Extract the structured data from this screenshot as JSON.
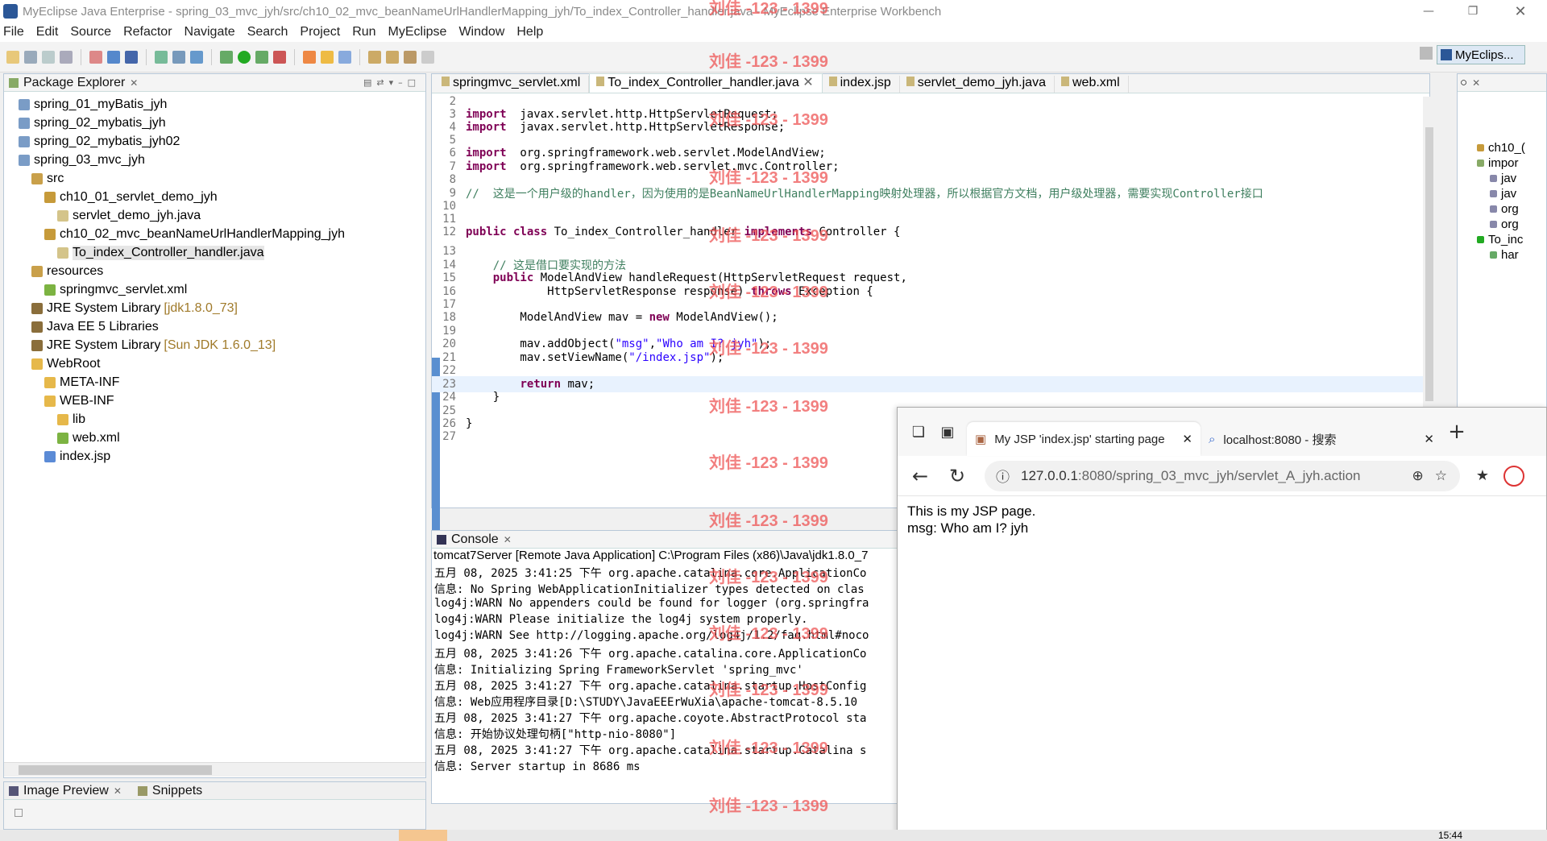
{
  "window": {
    "title": "MyEclipse Java Enterprise - spring_03_mvc_jyh/src/ch10_02_mvc_beanNameUrlHandlerMapping_jyh/To_index_Controller_handler.java - MyEclipse Enterprise Workbench",
    "perspective": "MyEclips..."
  },
  "menu": [
    "File",
    "Edit",
    "Source",
    "Refactor",
    "Navigate",
    "Search",
    "Project",
    "Run",
    "MyEclipse",
    "Window",
    "Help"
  ],
  "package_explorer": {
    "title": "Package Explorer",
    "items": [
      {
        "label": "spring_01_myBatis_jyh",
        "indent": 0,
        "icon": "project"
      },
      {
        "label": "spring_02_mybatis_jyh",
        "indent": 0,
        "icon": "project"
      },
      {
        "label": "spring_02_mybatis_jyh02",
        "indent": 0,
        "icon": "project"
      },
      {
        "label": "spring_03_mvc_jyh",
        "indent": 0,
        "icon": "project"
      },
      {
        "label": "src",
        "indent": 1,
        "icon": "src-folder"
      },
      {
        "label": "ch10_01_servlet_demo_jyh",
        "indent": 2,
        "icon": "package"
      },
      {
        "label": "servlet_demo_jyh.java",
        "indent": 3,
        "icon": "java-file"
      },
      {
        "label": "ch10_02_mvc_beanNameUrlHandlerMapping_jyh",
        "indent": 2,
        "icon": "package"
      },
      {
        "label": "To_index_Controller_handler.java",
        "indent": 3,
        "icon": "java-file",
        "selected": true
      },
      {
        "label": "resources",
        "indent": 1,
        "icon": "src-folder"
      },
      {
        "label": "springmvc_servlet.xml",
        "indent": 2,
        "icon": "xml-file"
      },
      {
        "label": "JRE System Library",
        "deco": "[jdk1.8.0_73]",
        "indent": 1,
        "icon": "library"
      },
      {
        "label": "Java EE 5 Libraries",
        "indent": 1,
        "icon": "library"
      },
      {
        "label": "JRE System Library",
        "deco": "[Sun JDK 1.6.0_13]",
        "indent": 1,
        "icon": "library"
      },
      {
        "label": "WebRoot",
        "indent": 1,
        "icon": "folder"
      },
      {
        "label": "META-INF",
        "indent": 2,
        "icon": "folder"
      },
      {
        "label": "WEB-INF",
        "indent": 2,
        "icon": "folder"
      },
      {
        "label": "lib",
        "indent": 3,
        "icon": "folder"
      },
      {
        "label": "web.xml",
        "indent": 3,
        "icon": "xml-file"
      },
      {
        "label": "index.jsp",
        "indent": 2,
        "icon": "jsp-file"
      }
    ]
  },
  "bottom_left_tabs": [
    "Image Preview",
    "Snippets"
  ],
  "editor": {
    "tabs": [
      {
        "label": "springmvc_servlet.xml"
      },
      {
        "label": "To_index_Controller_handler.java",
        "active": true
      },
      {
        "label": "index.jsp"
      },
      {
        "label": "servlet_demo_jyh.java"
      },
      {
        "label": "web.xml"
      }
    ],
    "lines": [
      {
        "n": "2",
        "t": ""
      },
      {
        "n": "3",
        "segs": [
          [
            "kw",
            "import"
          ],
          [
            "",
            "  javax.servlet.http.HttpServletRequest;"
          ]
        ]
      },
      {
        "n": "4",
        "segs": [
          [
            "kw",
            "import"
          ],
          [
            "",
            "  javax.servlet.http.HttpServletResponse;"
          ]
        ]
      },
      {
        "n": "5",
        "t": ""
      },
      {
        "n": "6",
        "segs": [
          [
            "kw",
            "import"
          ],
          [
            "",
            "  org.springframework.web.servlet.ModelAndView;"
          ]
        ]
      },
      {
        "n": "7",
        "segs": [
          [
            "kw",
            "import"
          ],
          [
            "",
            "  org.springframework.web.servlet.mvc.Controller;"
          ]
        ]
      },
      {
        "n": "8",
        "t": ""
      },
      {
        "n": "9",
        "segs": [
          [
            "cm",
            "//  这是一个用户级的handler，因为使用的是BeanNameUrlHandlerMapping映射处理器，所以根据官方文档，用户级处理器，需要实现Controller接口"
          ]
        ]
      },
      {
        "n": "10",
        "t": ""
      },
      {
        "n": "11",
        "t": ""
      },
      {
        "n": "12",
        "segs": [
          [
            "kw",
            "public class"
          ],
          [
            "",
            " To_index_Controller_handler "
          ],
          [
            "kw",
            "implements"
          ],
          [
            "",
            " Controller {"
          ]
        ]
      },
      {
        "n": "13",
        "t": ""
      },
      {
        "n": "14",
        "segs": [
          [
            "",
            "    "
          ],
          [
            "cm",
            "// 这是借口要实现的方法"
          ]
        ]
      },
      {
        "n": "15",
        "segs": [
          [
            "",
            "    "
          ],
          [
            "kw",
            "public"
          ],
          [
            "",
            " ModelAndView handleRequest(HttpServletRequest request,"
          ]
        ]
      },
      {
        "n": "16",
        "segs": [
          [
            "",
            "            HttpServletResponse response) "
          ],
          [
            "kw",
            "throws"
          ],
          [
            "",
            " Exception {"
          ]
        ]
      },
      {
        "n": "17",
        "t": ""
      },
      {
        "n": "18",
        "segs": [
          [
            "",
            "        ModelAndView mav = "
          ],
          [
            "kw",
            "new"
          ],
          [
            "",
            " ModelAndView();"
          ]
        ]
      },
      {
        "n": "19",
        "t": ""
      },
      {
        "n": "20",
        "segs": [
          [
            "",
            "        mav.addObject("
          ],
          [
            "str",
            "\"msg\""
          ],
          [
            "",
            ","
          ],
          [
            "str",
            "\"Who am I? jyh\""
          ],
          [
            "",
            ");"
          ]
        ]
      },
      {
        "n": "21",
        "segs": [
          [
            "",
            "        mav.setViewName("
          ],
          [
            "str",
            "\"/index.jsp\""
          ],
          [
            "",
            ");"
          ]
        ]
      },
      {
        "n": "22",
        "t": ""
      },
      {
        "n": "23",
        "segs": [
          [
            "",
            "        "
          ],
          [
            "kw",
            "return"
          ],
          [
            "",
            " mav;"
          ]
        ]
      },
      {
        "n": "24",
        "segs": [
          [
            "",
            "    }"
          ]
        ]
      },
      {
        "n": "25",
        "t": ""
      },
      {
        "n": "26",
        "segs": [
          [
            "",
            "}"
          ]
        ]
      },
      {
        "n": "27",
        "t": ""
      }
    ]
  },
  "console": {
    "title": "Console",
    "header": "tomcat7Server [Remote Java Application] C:\\Program Files (x86)\\Java\\jdk1.8.0_7",
    "lines": [
      "五月 08, 2025 3:41:25 下午 org.apache.catalina.core.ApplicationCo",
      "信息: No Spring WebApplicationInitializer types detected on clas",
      "log4j:WARN No appenders could be found for logger (org.springfra",
      "log4j:WARN Please initialize the log4j system properly.",
      "log4j:WARN See http://logging.apache.org/log4j/1.2/faq.html#noco",
      "五月 08, 2025 3:41:26 下午 org.apache.catalina.core.ApplicationCo",
      "信息: Initializing Spring FrameworkServlet 'spring_mvc'",
      "五月 08, 2025 3:41:27 下午 org.apache.catalina.startup.HostConfig",
      "信息: Web应用程序目录[D:\\STUDY\\JavaEEErWuXia\\apache-tomcat-8.5.10",
      "五月 08, 2025 3:41:27 下午 org.apache.coyote.AbstractProtocol sta",
      "信息: 开始协议处理句柄[\"http-nio-8080\"]",
      "五月 08, 2025 3:41:27 下午 org.apache.catalina.startup.Catalina s",
      "信息: Server startup in 8686 ms"
    ]
  },
  "outline": {
    "items": [
      "ch10_(",
      "impor",
      "jav",
      "jav",
      "org",
      "org",
      "To_inc",
      "har"
    ]
  },
  "browser": {
    "tabs": [
      {
        "label": "My JSP 'index.jsp' starting page",
        "active": true
      },
      {
        "label": "localhost:8080 - 搜索"
      }
    ],
    "url_host": "127.0.0.1",
    "url_rest": ":8080/spring_03_mvc_jyh/servlet_A_jyh.action",
    "content": [
      "This is my JSP page.",
      "msg: Who am I? jyh"
    ]
  },
  "watermark": "刘佳 -123 - 1399",
  "clock": "15:44",
  "colors": {
    "keyword": "#7f0055",
    "comment": "#3f7f5f",
    "string": "#2a00ff",
    "watermark": "#ee5555"
  }
}
